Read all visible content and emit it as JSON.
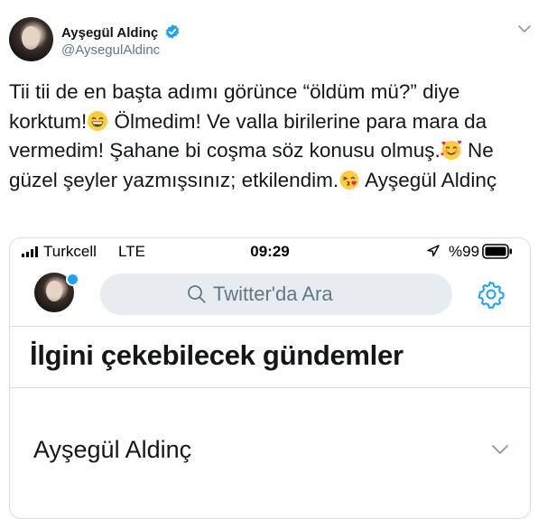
{
  "tweet": {
    "author_name": "Ayşegül Aldinç",
    "author_handle": "@AysegulAldinc",
    "text_parts": [
      "Tii tii de en başta adımı görünce “öldüm mü?” diye korktum!",
      " Ölmedim! Ve valla birilerine para mara da vermedim! Şahane bi coşma  söz konusu olmuş.",
      " Ne güzel şeyler yazmışsınız; etkilendim.",
      " Ayşegül Aldinç"
    ],
    "icons": [
      "verified-badge-icon",
      "chevron-down-icon",
      "grinning-emoji",
      "smiling-hearts-emoji",
      "kissing-heart-emoji",
      "heart-eyes-emoji"
    ]
  },
  "screenshot": {
    "status_bar": {
      "carrier": "Turkcell",
      "network": "LTE",
      "time": "09:29",
      "battery": "%99"
    },
    "search_placeholder": "Twitter'da Ara",
    "section_title": "İlgini çekebilecek gündemler",
    "trend_title": "Ayşegül Aldinç",
    "colors": {
      "accent": "#1da1f2",
      "search_bg": "#e6ecf0",
      "muted": "#657786"
    }
  }
}
